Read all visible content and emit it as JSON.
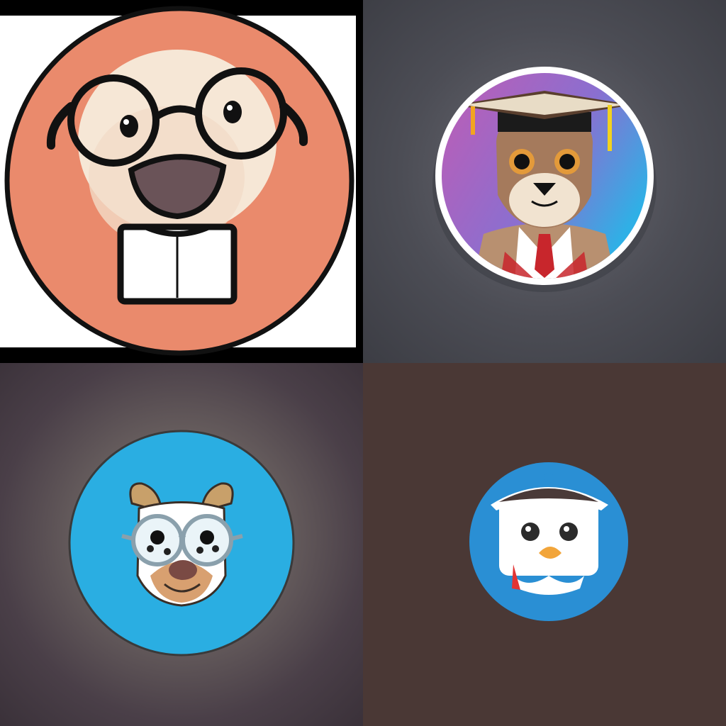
{
  "tiles": [
    {
      "subject": "dog-with-round-glasses",
      "background": "#000000",
      "badge_color": "#ea8a6c"
    },
    {
      "subject": "squirrel-with-graduation-cap",
      "background": "#4f5058",
      "badge_color": "#b35db3"
    },
    {
      "subject": "bear-with-glasses",
      "background": "#4a3f48",
      "badge_color": "#2aaee2"
    },
    {
      "subject": "bird-with-captain-hat",
      "background": "#4a3835",
      "badge_color": "#2a8fd4"
    }
  ]
}
